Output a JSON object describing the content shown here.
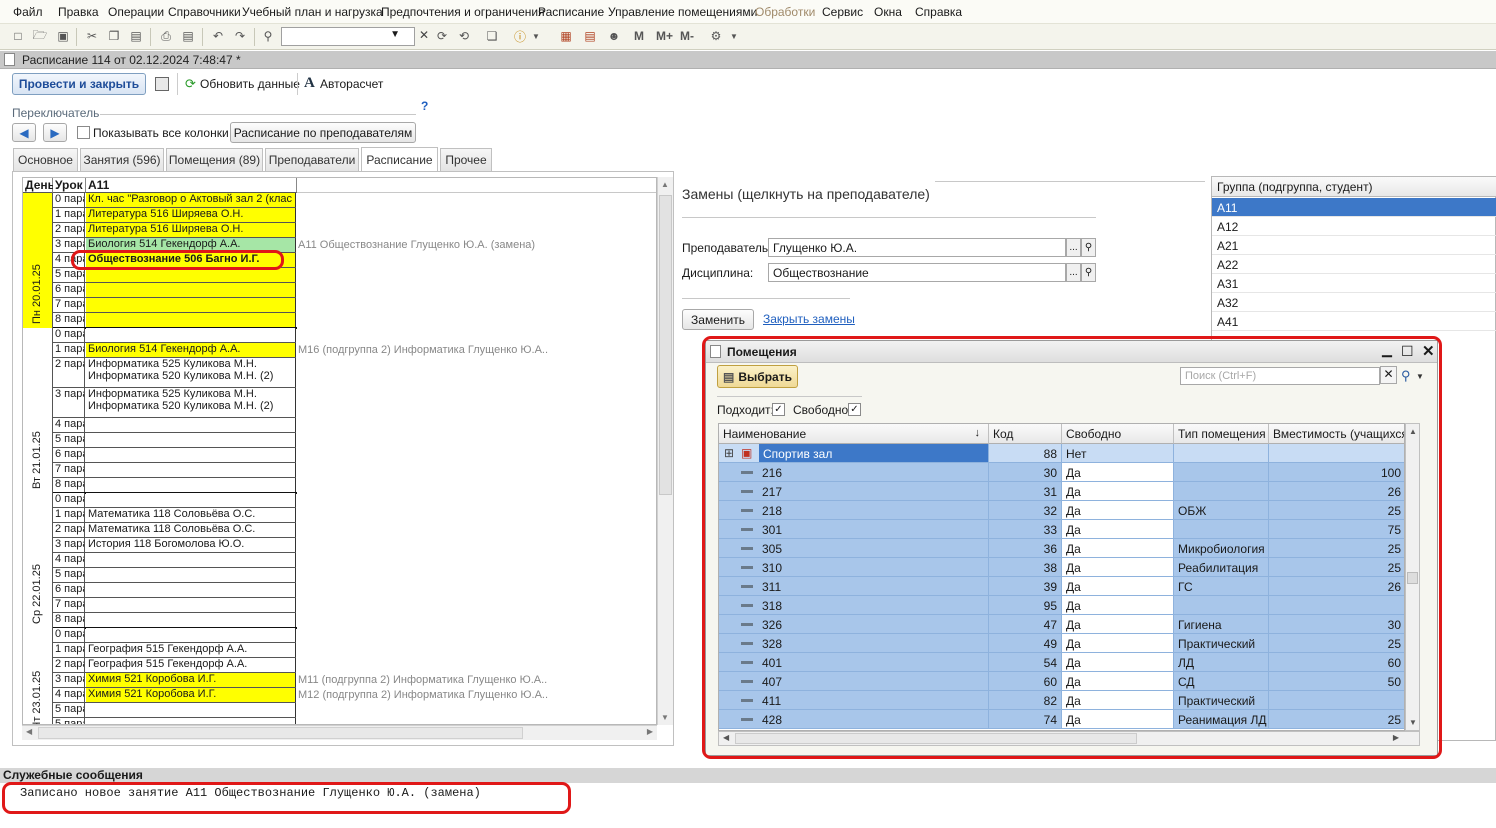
{
  "menu": [
    "Файл",
    "Правка",
    "Операции",
    "Справочники",
    "Учебный план и нагрузка",
    "Предпочтения и ограничения",
    "Расписание",
    "Управление помещениями",
    "Обработки",
    "Сервис",
    "Окна",
    "Справка"
  ],
  "toolbar": {
    "m_labels": [
      "M",
      "M+",
      "M-"
    ]
  },
  "window": {
    "title": "Расписание 114 от 02.12.2024 7:48:47 *"
  },
  "actions": {
    "post_close": "Провести и закрыть",
    "refresh": "Обновить данные",
    "autocalc": "Авторасчет"
  },
  "switcher": {
    "label": "Переключатель",
    "help": "?",
    "show_all_columns": "Показывать все колонки",
    "by_teachers": "Расписание по преподавателям"
  },
  "tabs": [
    "Основное",
    "Занятия (596)",
    "Помещения (89)",
    "Преподаватели",
    "Расписание",
    "Прочее"
  ],
  "schedule": {
    "headers": {
      "day": "День",
      "lesson": "Урок",
      "group": "А11"
    },
    "days": [
      {
        "label": "Пн 20.01.25",
        "color": "#ffff00",
        "rows": [
          {
            "u": "0 пара",
            "c": "Кл. час \"Разговор о  Актовый зал 2 (клас",
            "bg": "#ffff00"
          },
          {
            "u": "1 пара",
            "c": "Литература 516 Ширяева О.Н.",
            "bg": "#ffff00"
          },
          {
            "u": "2 пара",
            "c": "Литература 516 Ширяева О.Н.",
            "bg": "#ffff00"
          },
          {
            "u": "3 пара",
            "c": "Биология 514 Гекендорф А.А.",
            "bg": "#a6e6a6",
            "extra": "А11 Обществознание Глущенко Ю.А. (замена)"
          },
          {
            "u": "4 пара",
            "c": "Обществознание 506 Багно И.Г.",
            "bg": "#ffff00",
            "bold": true
          },
          {
            "u": "5 пара",
            "c": "",
            "bg": "#ffff00"
          },
          {
            "u": "6 пара",
            "c": "",
            "bg": "#ffff00"
          },
          {
            "u": "7 пара",
            "c": "",
            "bg": "#ffff00"
          },
          {
            "u": "8 пара",
            "c": "",
            "bg": "#ffff00"
          }
        ]
      },
      {
        "label": "Вт 21.01.25",
        "color": "#ffffff",
        "rows": [
          {
            "u": "0 пара",
            "c": "",
            "bg": "#ffffff"
          },
          {
            "u": "1 пара",
            "c": "Биология 514 Гекендорф А.А.",
            "bg": "#ffff00",
            "extra": "М16 (подгруппа 2) Информатика Глущенко Ю.А.."
          },
          {
            "u": "2 пара",
            "c": "Информатика 525 Куликова М.Н.",
            "c2": "Информатика 520 Куликова М.Н. (2)",
            "bg": "#ffffff"
          },
          {
            "u": "3 пара",
            "c": "Информатика 525 Куликова М.Н.",
            "c2": "Информатика 520 Куликова М.Н. (2)",
            "bg": "#ffffff"
          },
          {
            "u": "4 пара",
            "c": "",
            "bg": "#ffffff"
          },
          {
            "u": "5 пара",
            "c": "",
            "bg": "#ffffff"
          },
          {
            "u": "6 пара",
            "c": "",
            "bg": "#ffffff"
          },
          {
            "u": "7 пара",
            "c": "",
            "bg": "#ffffff"
          },
          {
            "u": "8 пара",
            "c": "",
            "bg": "#ffffff"
          }
        ]
      },
      {
        "label": "Ср 22.01.25",
        "color": "#ffffff",
        "rows": [
          {
            "u": "0 пара",
            "c": "",
            "bg": "#ffffff"
          },
          {
            "u": "1 пара",
            "c": "Математика 118 Соловьёва О.С.",
            "bg": "#ffffff"
          },
          {
            "u": "2 пара",
            "c": "Математика 118 Соловьёва О.С.",
            "bg": "#ffffff"
          },
          {
            "u": "3 пара",
            "c": "История 118 Богомолова Ю.О.",
            "bg": "#ffffff"
          },
          {
            "u": "4 пара",
            "c": "",
            "bg": "#ffffff"
          },
          {
            "u": "5 пара",
            "c": "",
            "bg": "#ffffff"
          },
          {
            "u": "6 пара",
            "c": "",
            "bg": "#ffffff"
          },
          {
            "u": "7 пара",
            "c": "",
            "bg": "#ffffff"
          },
          {
            "u": "8 пара",
            "c": "",
            "bg": "#ffffff"
          }
        ]
      },
      {
        "label": "Чт 23.01.25",
        "color": "#ffffff",
        "rows": [
          {
            "u": "0 пара",
            "c": "",
            "bg": "#ffffff"
          },
          {
            "u": "1 пара",
            "c": "География 515 Гекендорф А.А.",
            "bg": "#ffffff"
          },
          {
            "u": "2 пара",
            "c": "География 515 Гекендорф А.А.",
            "bg": "#ffffff"
          },
          {
            "u": "3 пара",
            "c": "Химия 521 Коробова И.Г.",
            "bg": "#ffff00",
            "extra": "М11 (подгруппа 2) Информатика Глущенко Ю.А.."
          },
          {
            "u": "4 пара",
            "c": "Химия 521 Коробова И.Г.",
            "bg": "#ffff00",
            "extra": "М12 (подгруппа 2) Информатика Глущенко Ю.А.."
          },
          {
            "u": "5 пара",
            "c": "",
            "bg": "#ffffff"
          },
          {
            "u": "5 пара",
            "c": "",
            "bg": "#ffffff"
          }
        ]
      }
    ]
  },
  "replacements": {
    "title": "Замены (щелкнуть на преподавателе)",
    "teacher_label": "Преподаватель:",
    "teacher_value": "Глущенко Ю.А.",
    "discipline_label": "Дисциплина:",
    "discipline_value": "Обществознание",
    "replace_button": "Заменить",
    "close_link": "Закрыть замены"
  },
  "groups": {
    "header": "Группа (подгруппа, студент)",
    "items": [
      "А11",
      "А12",
      "А21",
      "А22",
      "А31",
      "А32",
      "А41"
    ],
    "selected": "А11"
  },
  "rooms_dialog": {
    "title": "Помещения",
    "select_button": "Выбрать",
    "search_placeholder": "Поиск (Ctrl+F)",
    "fits_label": "Подходит:",
    "free_label": "Свободно:",
    "columns": [
      "Наименование",
      "Код",
      "Свободно",
      "Тип помещения",
      "Вместимость (учащихся)"
    ],
    "rows": [
      {
        "name": "Спортив зал",
        "code": "88",
        "free": "Нет",
        "type": "",
        "cap": "",
        "group": true
      },
      {
        "name": "216",
        "code": "30",
        "free": "Да",
        "type": "",
        "cap": "100"
      },
      {
        "name": "217",
        "code": "31",
        "free": "Да",
        "type": "",
        "cap": "26"
      },
      {
        "name": "218",
        "code": "32",
        "free": "Да",
        "type": "ОБЖ",
        "cap": "25"
      },
      {
        "name": "301",
        "code": "33",
        "free": "Да",
        "type": "",
        "cap": "75"
      },
      {
        "name": "305",
        "code": "36",
        "free": "Да",
        "type": "Микробиология",
        "cap": "25"
      },
      {
        "name": "310",
        "code": "38",
        "free": "Да",
        "type": "Реабилитация",
        "cap": "25"
      },
      {
        "name": "311",
        "code": "39",
        "free": "Да",
        "type": "ГС",
        "cap": "26"
      },
      {
        "name": "318",
        "code": "95",
        "free": "Да",
        "type": "",
        "cap": ""
      },
      {
        "name": "326",
        "code": "47",
        "free": "Да",
        "type": "Гигиена",
        "cap": "30"
      },
      {
        "name": "328",
        "code": "49",
        "free": "Да",
        "type": "Практический",
        "cap": "25"
      },
      {
        "name": "401",
        "code": "54",
        "free": "Да",
        "type": "ЛД",
        "cap": "60"
      },
      {
        "name": "407",
        "code": "60",
        "free": "Да",
        "type": "СД",
        "cap": "50"
      },
      {
        "name": "411",
        "code": "82",
        "free": "Да",
        "type": "Практический",
        "cap": ""
      },
      {
        "name": "428",
        "code": "74",
        "free": "Да",
        "type": "Реанимация ЛД",
        "cap": "25"
      }
    ]
  },
  "messages": {
    "header": "Служебные сообщения",
    "text": "Записано новое занятие А11 Обществознание Глущенко Ю.А. (замена)"
  },
  "colors": {
    "highlight_red": "#e01818",
    "room_row": "#a8c6ea",
    "yellow": "#ffff00",
    "green": "#a6e6a6"
  }
}
